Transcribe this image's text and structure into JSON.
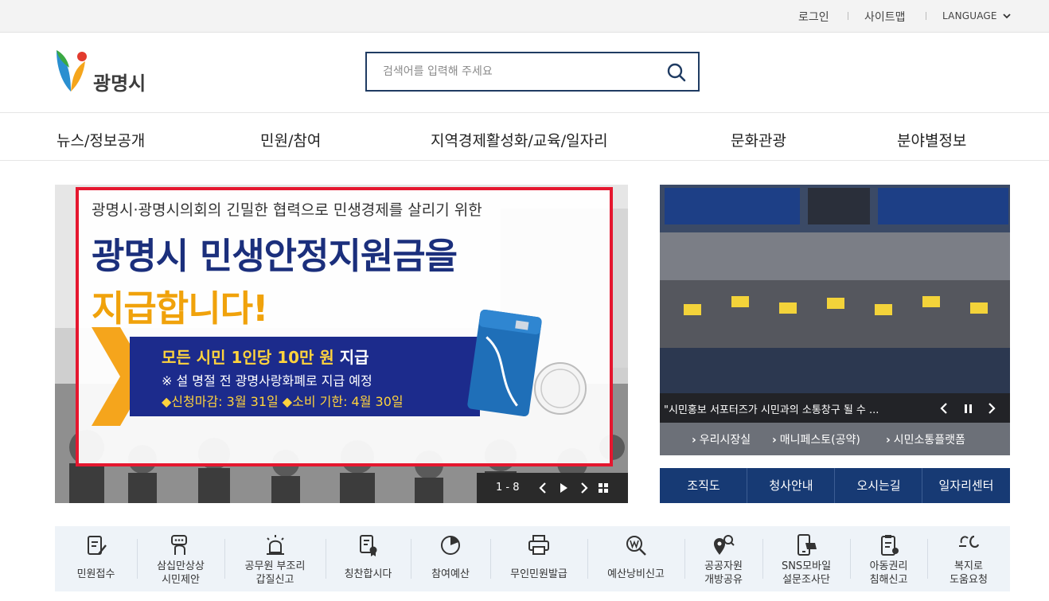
{
  "topbar": {
    "login": "로그인",
    "sitemap": "사이트맵",
    "language": "LANGUAGE"
  },
  "header": {
    "logo_text": "광명시",
    "search_placeholder": "검색어를 입력해 주세요"
  },
  "nav": {
    "items": [
      "뉴스/정보공개",
      "민원/참여",
      "지역경제활성화/교육/일자리",
      "문화관광",
      "분야별정보"
    ]
  },
  "banner": {
    "subtitle": "광명시·광명시의회의 긴밀한 협력으로 민생경제를 살리기 위한",
    "title_line1": "광명시 민생안정지원금을",
    "title_line2": "지급합니다!",
    "box_line1_a": "모든 시민 1인당 10만 원 ",
    "box_line1_b": "지급",
    "box_line2": "※ 설 명절 전 광명사랑화폐로 지급 예정",
    "box_line3": "◆신청마감: 3월 31일  ◆소비 기한: 4월 30일",
    "pager": "1 - 8"
  },
  "photo": {
    "caption": "\"시민홍보 서포터즈가 시민과의 소통창구 될 수 ..."
  },
  "quick_links": [
    "우리시장실",
    "매니페스토(공약)",
    "시민소통플랫폼"
  ],
  "nav_buttons": [
    "조직도",
    "청사안내",
    "오시는길",
    "일자리센터"
  ],
  "services": [
    {
      "label": [
        "민원접수"
      ],
      "icon": "document-pen-icon"
    },
    {
      "label": [
        "삼십만상상",
        "시민제안"
      ],
      "icon": "idea-chat-icon"
    },
    {
      "label": [
        "공무원 부조리",
        "갑질신고"
      ],
      "icon": "siren-icon"
    },
    {
      "label": [
        "칭찬합시다"
      ],
      "icon": "award-document-icon"
    },
    {
      "label": [
        "참여예산"
      ],
      "icon": "pie-chart-icon"
    },
    {
      "label": [
        "무인민원발급"
      ],
      "icon": "printer-icon"
    },
    {
      "label": [
        "예산낭비신고"
      ],
      "icon": "won-search-icon"
    },
    {
      "label": [
        "공공자원",
        "개방공유"
      ],
      "icon": "location-search-icon"
    },
    {
      "label": [
        "SNS모바일",
        "설문조사단"
      ],
      "icon": "mobile-survey-icon"
    },
    {
      "label": [
        "아동권리",
        "침해신고"
      ],
      "icon": "clipboard-child-icon"
    },
    {
      "label": [
        "복지로",
        "도움요청"
      ],
      "icon": "welfare-call-icon"
    }
  ],
  "colors": {
    "primary_navy": "#173a74",
    "banner_red_frame": "#e5172f",
    "title_navy": "#1b2f7c",
    "title_yellow": "#f0a20b"
  }
}
